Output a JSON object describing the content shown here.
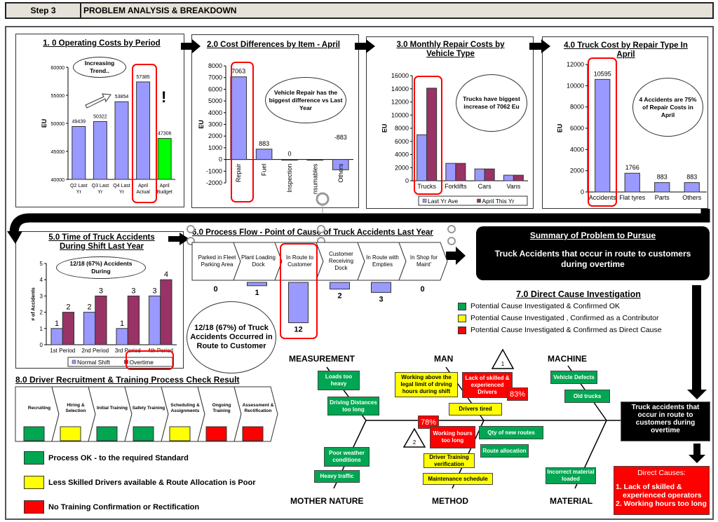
{
  "header": {
    "step": "Step 3",
    "title": "PROBLEM ANALYSIS & BREAKDOWN"
  },
  "colors": {
    "bar": "#9999ff",
    "bar_alt": "#993366",
    "budget": "#00ff00",
    "ok": "#00a651",
    "contributor": "#ffff00",
    "direct": "#ff0000",
    "highlight": "#ff0000"
  },
  "chart_data": [
    {
      "id": "c1",
      "type": "bar",
      "title": "1. 0 Operating Costs by Period",
      "ylabel": "EU",
      "ylim": [
        40000,
        60000
      ],
      "ytick": 5000,
      "categories": [
        "Q2 Last|Yr",
        "Q3 Last|Yr",
        "Q4 Last|Yr",
        "April|Actual",
        "April|Budget"
      ],
      "values": [
        49439,
        50322,
        53854,
        57385,
        47306
      ],
      "labels": [
        "49439",
        "50322",
        "53854",
        "57385",
        "47306"
      ],
      "bar_colors": [
        "#9999ff",
        "#9999ff",
        "#9999ff",
        "#9999ff",
        "#00ff00"
      ],
      "annotations": [
        "Increasing Trend..",
        "!"
      ]
    },
    {
      "id": "c2",
      "type": "bar",
      "title": "2.0 Cost Differences by Item - April",
      "ylabel": "EU",
      "ylim": [
        -2000,
        8000
      ],
      "ytick": 1000,
      "categories": [
        "Repair",
        "Fuel",
        "Inspection",
        "nsumables",
        "Others"
      ],
      "values": [
        7063,
        883,
        0,
        -40,
        -883
      ],
      "labels": [
        "7063",
        "883",
        "0",
        "",
        "-883"
      ],
      "annotations": [
        "Vehicle Repair has the biggest difference vs Last Year"
      ]
    },
    {
      "id": "c3",
      "type": "bar",
      "title": "3.0 Monthly Repair Costs by Vehicle Type",
      "ylabel": "EU",
      "ylim": [
        0,
        16000
      ],
      "ytick": 2000,
      "categories": [
        "Trucks",
        "Forklifts",
        "Cars",
        "Vans"
      ],
      "series": [
        {
          "name": "Last Yr Ave",
          "values": [
            7000,
            2650,
            1800,
            850
          ],
          "color": "#9999ff"
        },
        {
          "name": "April This Yr",
          "values": [
            14100,
            2650,
            1800,
            850
          ],
          "color": "#993366"
        }
      ],
      "legend": "bottom",
      "annotations": [
        "Trucks have biggest increase of 7062 Eu"
      ]
    },
    {
      "id": "c4",
      "type": "bar",
      "title": "4.0 Truck Cost by Repair Type In April",
      "ylabel": "EU",
      "ylim": [
        0,
        12000
      ],
      "ytick": 2000,
      "categories": [
        "Accidents",
        "Flat tyres",
        "Parts",
        "Others"
      ],
      "values": [
        10595,
        1766,
        883,
        883
      ],
      "labels": [
        "10595",
        "1766",
        "883",
        "883"
      ],
      "annotations": [
        "4 Accidents are 75% of Repair Costs in April"
      ]
    },
    {
      "id": "c5",
      "type": "bar",
      "title": "5.0 Time of Truck Accidents During Shift Last Year",
      "ylabel": "# of Accidents",
      "ylim": [
        0,
        5
      ],
      "ytick": 1,
      "categories": [
        "1st Period",
        "2nd Period",
        "3rd Period",
        "4th Period"
      ],
      "series": [
        {
          "name": "Normal Shift",
          "values": [
            1,
            2,
            1,
            3
          ],
          "color": "#9999ff"
        },
        {
          "name": "Overtime",
          "values": [
            2,
            3,
            3,
            4
          ],
          "color": "#993366"
        }
      ],
      "legend": "bottom",
      "annotations": [
        "12/18 (67%) Accidents During"
      ]
    },
    {
      "id": "c6",
      "type": "bar",
      "title": "6.0 Process Flow - Point of Cause of Truck Accidents Last Year",
      "categories": [
        "Parked in Fleet Parking Area",
        "Plant Loading Dock",
        "In Route to Customer",
        "Customer Receiving Dock",
        "In Route with Empties",
        "In Shop for Maint'"
      ],
      "values": [
        0,
        1,
        12,
        2,
        3,
        0
      ],
      "labels": [
        "0",
        "1",
        "12",
        "2",
        "3",
        "0"
      ],
      "annotations": [
        "12/18 (67%) of Truck Accidents Occurred in Route to Customer"
      ]
    }
  ],
  "summary": {
    "title": "Summary of Problem to Pursue",
    "text": "Truck Accidents that occur in route to customers during overtime"
  },
  "investigation": {
    "title": "7.0 Direct Cause Investigation",
    "legend": [
      {
        "label": "Potential Cause Investigated & Confirmed OK",
        "color": "#00a651"
      },
      {
        "label": "Potential Cause Investigated , Confirmed as a Contributor",
        "color": "#ffff00"
      },
      {
        "label": "Potential Cause Investigated & Confirmed as Direct Cause",
        "color": "#ff0000"
      }
    ]
  },
  "fishbone": {
    "categories": [
      "MEASUREMENT",
      "MAN",
      "MACHINE",
      "MOTHER NATURE",
      "METHOD",
      "MATERIAL"
    ],
    "causes": [
      "Loads too heavy",
      "Driving Distances too long",
      "Working above the legal limit of drving hours during shift",
      "Lack of skilled & experienced Drivers",
      "Drivers tired",
      "Working hours too long",
      "Qty of new routes",
      "Route allocation",
      "Driver Training verification",
      "Maintenance schedule",
      "Vehicle Defects",
      "Old trucks",
      "Incorrect material loaded",
      "Poor weather conditions",
      "Heavy traffic"
    ],
    "percent_1": "83%",
    "percent_2": "78%",
    "marker_1": "1",
    "marker_2": "2",
    "effect": "Truck accidents that occur in route to customers during overtime"
  },
  "direct_causes": {
    "title": "Direct Causes:",
    "items": [
      "1. Lack of skilled & experienced operators",
      "2. Working hours too long"
    ]
  },
  "process_check": {
    "title": "8.0 Driver Recruitment & Training Process Check Result",
    "steps": [
      {
        "label": "Recruiting",
        "status": "#00a651"
      },
      {
        "label": "Hiring & Selection",
        "status": "#ffff00"
      },
      {
        "label": "Initial Training",
        "status": "#00a651"
      },
      {
        "label": "Safety Training",
        "status": "#00a651"
      },
      {
        "label": "Scheduling & Assignments",
        "status": "#ffff00"
      },
      {
        "label": "Ongoing Training",
        "status": "#ff0000"
      },
      {
        "label": "Assessment & Rectification",
        "status": "#ff0000"
      }
    ],
    "legend": [
      {
        "label": "Process OK - to the required Standard",
        "color": "#00a651"
      },
      {
        "label": "Less Skilled Drivers available & Route Allocation is Poor",
        "color": "#ffff00"
      },
      {
        "label": "No Training Confirmation or Rectification",
        "color": "#ff0000"
      }
    ]
  }
}
